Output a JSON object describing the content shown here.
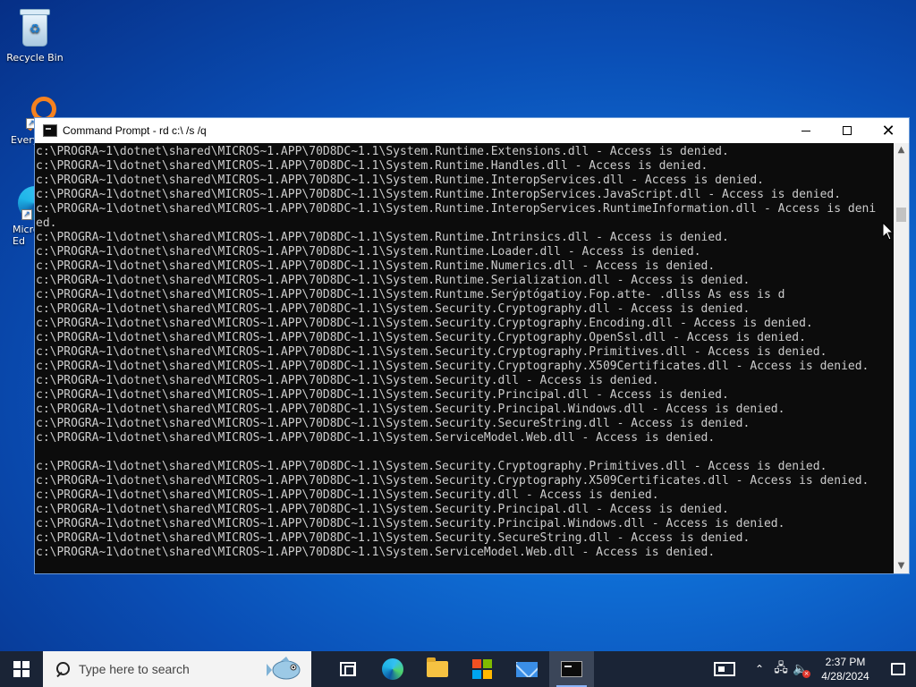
{
  "desktop": {
    "icons": [
      {
        "label": "Recycle Bin"
      },
      {
        "label": "Every"
      },
      {
        "label": "Micro Ed"
      }
    ]
  },
  "window": {
    "title": "Command Prompt - rd  c:\\ /s /q",
    "lines": [
      "c:\\PROGRA~1\\dotnet\\shared\\MICROS~1.APP\\70D8DC~1.1\\System.Runtime.Extensions.dll - Access is denied.",
      "c:\\PROGRA~1\\dotnet\\shared\\MICROS~1.APP\\70D8DC~1.1\\System.Runtime.Handles.dll - Access is denied.",
      "c:\\PROGRA~1\\dotnet\\shared\\MICROS~1.APP\\70D8DC~1.1\\System.Runtime.InteropServices.dll - Access is denied.",
      "c:\\PROGRA~1\\dotnet\\shared\\MICROS~1.APP\\70D8DC~1.1\\System.Runtime.InteropServices.JavaScript.dll - Access is denied.",
      "c:\\PROGRA~1\\dotnet\\shared\\MICROS~1.APP\\70D8DC~1.1\\System.Runtime.InteropServices.RuntimeInformation.dll - Access is deni",
      "ed.",
      "c:\\PROGRA~1\\dotnet\\shared\\MICROS~1.APP\\70D8DC~1.1\\System.Runtime.Intrinsics.dll - Access is denied.",
      "c:\\PROGRA~1\\dotnet\\shared\\MICROS~1.APP\\70D8DC~1.1\\System.Runtime.Loader.dll - Access is denied.",
      "c:\\PROGRA~1\\dotnet\\shared\\MICROS~1.APP\\70D8DC~1.1\\System.Runtime.Numerics.dll - Access is denied.",
      "c:\\PROGRA~1\\dotnet\\shared\\MICROS~1.APP\\70D8DC~1.1\\System.Runtime.Serialization.dll - Access is denied.",
      "c:\\PROGRA~1\\dotnet\\shared\\MICROS~1.APP\\70D8DC~1.1\\System.Runtıme.Serýptógatioy.Fop.atte- .dllss As ess is d",
      "c:\\PROGRA~1\\dotnet\\shared\\MICROS~1.APP\\70D8DC~1.1\\System.Security.Cryptography.dll - Access is denied.",
      "c:\\PROGRA~1\\dotnet\\shared\\MICROS~1.APP\\70D8DC~1.1\\System.Security.Cryptography.Encoding.dll - Access is denied.",
      "c:\\PROGRA~1\\dotnet\\shared\\MICROS~1.APP\\70D8DC~1.1\\System.Security.Cryptography.OpenSsl.dll - Access is denied.",
      "c:\\PROGRA~1\\dotnet\\shared\\MICROS~1.APP\\70D8DC~1.1\\System.Security.Cryptography.Primitives.dll - Access is denied.",
      "c:\\PROGRA~1\\dotnet\\shared\\MICROS~1.APP\\70D8DC~1.1\\System.Security.Cryptography.X509Certificates.dll - Access is denied.",
      "c:\\PROGRA~1\\dotnet\\shared\\MICROS~1.APP\\70D8DC~1.1\\System.Security.dll - Access is denied.",
      "c:\\PROGRA~1\\dotnet\\shared\\MICROS~1.APP\\70D8DC~1.1\\System.Security.Principal.dll - Access is denied.",
      "c:\\PROGRA~1\\dotnet\\shared\\MICROS~1.APP\\70D8DC~1.1\\System.Security.Principal.Windows.dll - Access is denied.",
      "c:\\PROGRA~1\\dotnet\\shared\\MICROS~1.APP\\70D8DC~1.1\\System.Security.SecureString.dll - Access is denied.",
      "c:\\PROGRA~1\\dotnet\\shared\\MICROS~1.APP\\70D8DC~1.1\\System.ServiceModel.Web.dll - Access is denied.",
      "",
      "c:\\PROGRA~1\\dotnet\\shared\\MICROS~1.APP\\70D8DC~1.1\\System.Security.Cryptography.Primitives.dll - Access is denied.",
      "c:\\PROGRA~1\\dotnet\\shared\\MICROS~1.APP\\70D8DC~1.1\\System.Security.Cryptography.X509Certificates.dll - Access is denied.",
      "c:\\PROGRA~1\\dotnet\\shared\\MICROS~1.APP\\70D8DC~1.1\\System.Security.dll - Access is denied.",
      "c:\\PROGRA~1\\dotnet\\shared\\MICROS~1.APP\\70D8DC~1.1\\System.Security.Principal.dll - Access is denied.",
      "c:\\PROGRA~1\\dotnet\\shared\\MICROS~1.APP\\70D8DC~1.1\\System.Security.Principal.Windows.dll - Access is denied.",
      "c:\\PROGRA~1\\dotnet\\shared\\MICROS~1.APP\\70D8DC~1.1\\System.Security.SecureString.dll - Access is denied.",
      "c:\\PROGRA~1\\dotnet\\shared\\MICROS~1.APP\\70D8DC~1.1\\System.ServiceModel.Web.dll - Access is denied."
    ]
  },
  "taskbar": {
    "search_placeholder": "Type here to search",
    "time": "2:37 PM",
    "date": "4/28/2024"
  },
  "colors": {
    "console_bg": "#0c0c0c",
    "console_text": "#cccccc",
    "taskbar_bg": "#1a2436"
  }
}
